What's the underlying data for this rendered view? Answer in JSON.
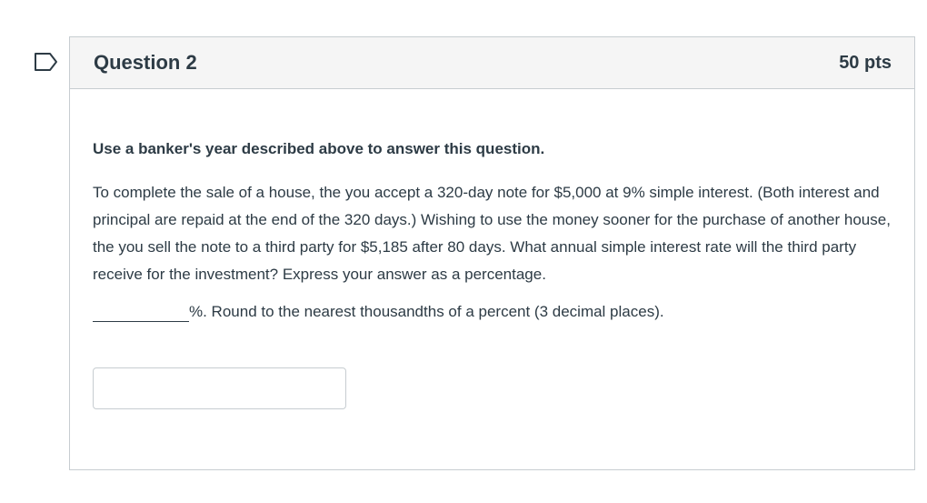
{
  "question": {
    "title": "Question 2",
    "points": "50 pts",
    "instruction": "Use a banker's year described above to answer this question.",
    "problem_text": "To complete the sale of a house, the you accept a 320-day note for $5,000 at 9% simple interest. (Both interest and principal are repaid at the end of the 320 days.) Wishing to use the money sooner for the purchase of another house, the you sell the note to a third party for $5,185 after 80 days. What annual simple interest rate will the third party receive for the investment?  Express your answer as a percentage.",
    "answer_suffix": "%. Round to the nearest thousandths of a percent (3 decimal places).",
    "answer_value": "",
    "answer_placeholder": ""
  },
  "icons": {
    "flag": "flag-question-icon"
  },
  "colors": {
    "text": "#2d3b45",
    "header_bg": "#f5f5f5",
    "border": "#c7cdd1"
  }
}
